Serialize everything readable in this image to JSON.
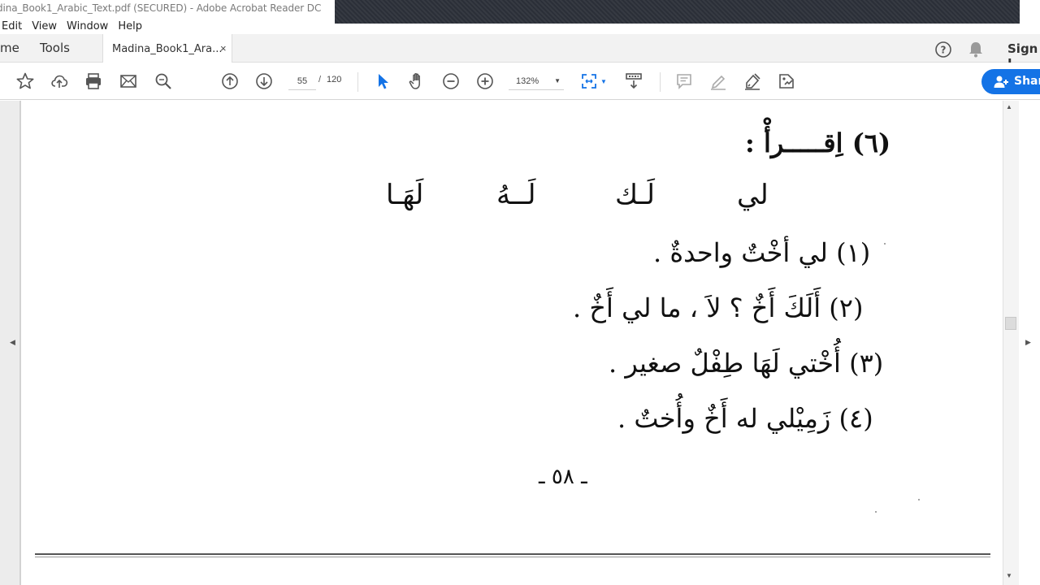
{
  "window": {
    "title": "dina_Book1_Arabic_Text.pdf (SECURED) - Adobe Acrobat Reader DC"
  },
  "menu": {
    "items": [
      "Edit",
      "View",
      "Window",
      "Help"
    ]
  },
  "tabs": {
    "home_label": "me",
    "tools_label": "Tools",
    "document_label": "Madina_Book1_Ara...",
    "close_glyph": "×",
    "sign_in_label": "Sign I"
  },
  "toolbar": {
    "page_current": "55",
    "page_separator": "/",
    "page_total": "120",
    "zoom": "132%",
    "share_label": "Shar",
    "accent_color": "#1473e6"
  },
  "document": {
    "heading": "(٦) اِقـــــرأْ :",
    "words": [
      "لي",
      "لَـك",
      "لَــهُ",
      "لَهَـا"
    ],
    "lines": [
      "(١) لي أخْتٌ واحدةٌ .",
      "(٢) أَلَكَ أَخٌ ؟ لاَ ، ما لي أَخٌ .",
      "(٣) أُخْتي لَهَا طِفْلٌ صغير .",
      "(٤) زَمِيْلي له أَخٌ وأُختٌ ."
    ],
    "page_number": "ـ ٥٨ ـ"
  }
}
